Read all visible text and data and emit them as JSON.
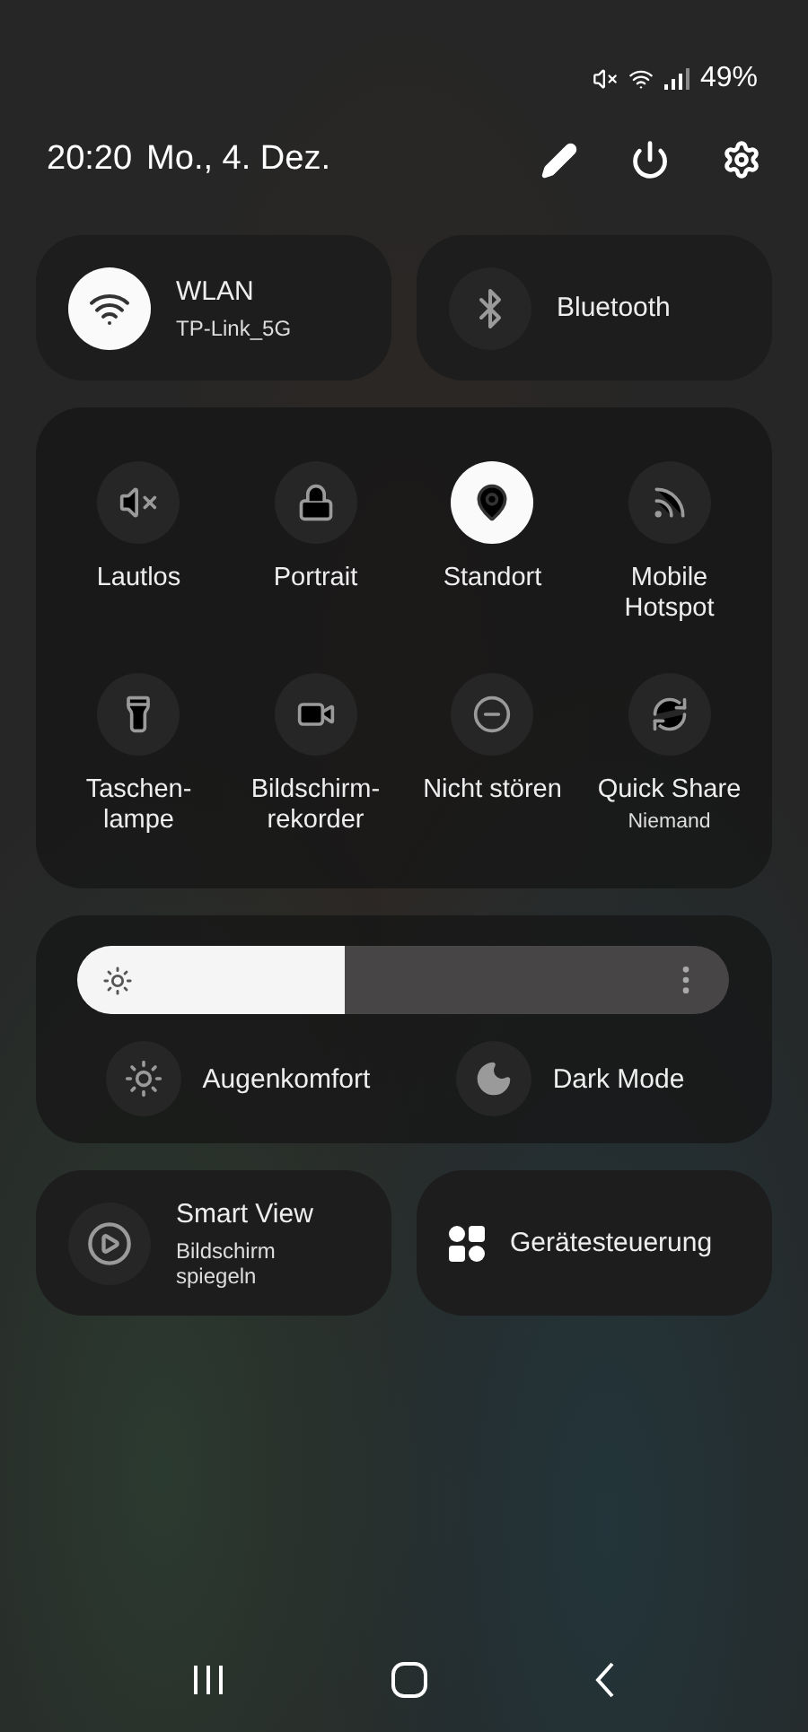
{
  "status_bar": {
    "battery": "49%"
  },
  "header": {
    "time": "20:20",
    "date": "Mo., 4. Dez."
  },
  "top_tiles": [
    {
      "title": "WLAN",
      "subtitle": "TP-Link_5G",
      "on": true
    },
    {
      "title": "Bluetooth",
      "on": false
    }
  ],
  "quick_toggles": [
    {
      "label": "Lautlos",
      "on": false
    },
    {
      "label": "Portrait",
      "on": false
    },
    {
      "label": "Standort",
      "on": true
    },
    {
      "label": "Mobile Hotspot",
      "on": false
    },
    {
      "label": "Taschen-lampe",
      "on": false
    },
    {
      "label": "Bildschirm-rekorder",
      "on": false
    },
    {
      "label": "Nicht stören",
      "on": false
    },
    {
      "label": "Quick Share",
      "sublabel": "Niemand",
      "on": false
    }
  ],
  "brightness": {
    "level": 0.41
  },
  "mode_toggles": [
    {
      "label": "Augenkomfort",
      "on": false
    },
    {
      "label": "Dark Mode",
      "on": false
    }
  ],
  "bottom_tiles": [
    {
      "title": "Smart View",
      "subtitle": "Bildschirm spiegeln"
    },
    {
      "title": "Gerätesteuerung"
    }
  ]
}
